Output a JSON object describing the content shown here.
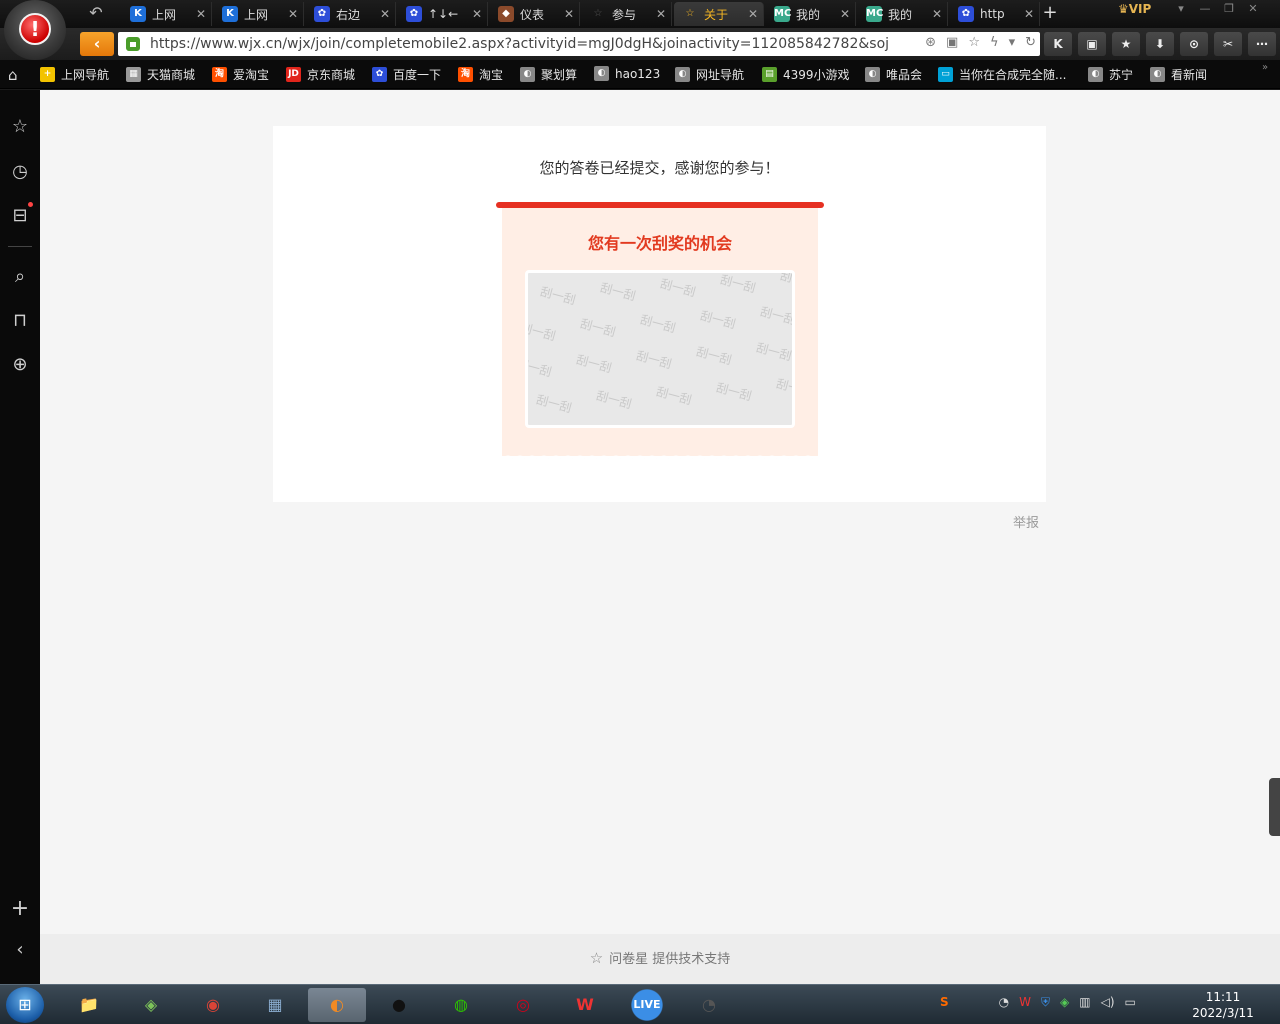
{
  "browser": {
    "tabs": [
      {
        "label": "上网",
        "favicon": "K",
        "color": "#1e6fd9"
      },
      {
        "label": "上网",
        "favicon": "K",
        "color": "#1e6fd9"
      },
      {
        "label": "右边",
        "favicon": "baidu",
        "color": "#2d4ed8"
      },
      {
        "label": "↑↓←",
        "favicon": "baidu",
        "color": "#2d4ed8"
      },
      {
        "label": "仪表",
        "favicon": "app",
        "color": "#8b4a2b"
      },
      {
        "label": "参与",
        "favicon": "star",
        "color": "#555555"
      },
      {
        "label": "关于",
        "favicon": "star",
        "color": "#f5b623"
      },
      {
        "label": "我的",
        "favicon": "MC",
        "color": "#3aa98c"
      },
      {
        "label": "我的",
        "favicon": "MC",
        "color": "#3aa98c"
      },
      {
        "label": "http",
        "favicon": "baidu",
        "color": "#2d4ed8"
      }
    ],
    "active_tab_index": 6,
    "vip_label": "VIP",
    "url": "https://www.wjx.cn/wjx/join/completemobile2.aspx?activityid=mgJ0dgH&joinactivity=112085842782&soju..."
  },
  "bookmarks": [
    {
      "label": "上网导航",
      "color": "#f3c300"
    },
    {
      "label": "天猫商城",
      "color": "#999999"
    },
    {
      "label": "爱淘宝",
      "color": "#ff5000"
    },
    {
      "label": "京东商城",
      "color": "#e1251b"
    },
    {
      "label": "百度一下",
      "color": "#2d4ed8"
    },
    {
      "label": "淘宝",
      "color": "#ff5000"
    },
    {
      "label": "聚划算",
      "color": "#888888"
    },
    {
      "label": "hao123",
      "color": "#888888"
    },
    {
      "label": "网址导航",
      "color": "#888888"
    },
    {
      "label": "4399小游戏",
      "color": "#5aa02c"
    },
    {
      "label": "唯品会",
      "color": "#888888"
    },
    {
      "label": "当你在合成完全随...",
      "color": "#00a1d6"
    },
    {
      "label": "苏宁",
      "color": "#888888"
    },
    {
      "label": "看新闻",
      "color": "#888888"
    }
  ],
  "page": {
    "thanks_message": "您的答卷已经提交，感谢您的参与！",
    "scratch_title": "您有一次刮奖的机会",
    "scratch_watermark": "刮一刮",
    "report_link": "举报",
    "footer_text": "问卷星 提供技术支持"
  },
  "taskbar": {
    "apps": [
      {
        "name": "explorer",
        "glyph": "📁",
        "active": false
      },
      {
        "name": "maps",
        "glyph": "◈",
        "active": false
      },
      {
        "name": "chrome",
        "glyph": "◉",
        "active": false
      },
      {
        "name": "monitor",
        "glyph": "▦",
        "active": false
      },
      {
        "name": "browser",
        "glyph": "◐",
        "active": true
      },
      {
        "name": "qq",
        "glyph": "●",
        "active": false
      },
      {
        "name": "wechat",
        "glyph": "◍",
        "active": false
      },
      {
        "name": "netease-music",
        "glyph": "◎",
        "active": false
      },
      {
        "name": "wps",
        "glyph": "W",
        "active": false
      },
      {
        "name": "live",
        "glyph": "LIVE",
        "active": false
      },
      {
        "name": "owl-app",
        "glyph": "◔",
        "active": false
      }
    ],
    "time": "11:11",
    "date": "2022/3/11"
  },
  "colors": {
    "accent_orange": "#e4780a",
    "scratch_red": "#e23a20",
    "scratch_bg": "#ffeee5"
  }
}
